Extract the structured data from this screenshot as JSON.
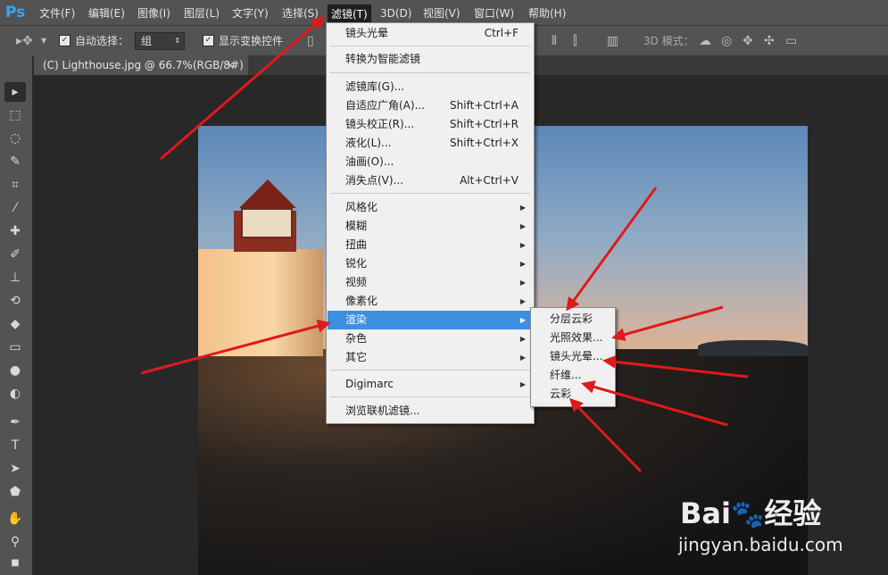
{
  "app": {
    "logo": "Ps"
  },
  "menubar": {
    "items": [
      "文件(F)",
      "编辑(E)",
      "图像(I)",
      "图层(L)",
      "文字(Y)",
      "选择(S)",
      "滤镜(T)",
      "3D(D)",
      "视图(V)",
      "窗口(W)",
      "帮助(H)"
    ],
    "active": "滤镜(T)"
  },
  "options": {
    "auto_select_label": "自动选择：",
    "group_value": "组",
    "show_transform_label": "显示变换控件",
    "mode_3d_label": "3D 模式："
  },
  "document": {
    "tab_title": "(C) Lighthouse.jpg @ 66.7%(RGB/8#)",
    "close": "×"
  },
  "filter_menu": {
    "items": [
      {
        "label": "镜头光晕",
        "shortcut": "Ctrl+F"
      },
      {
        "label": "转换为智能滤镜"
      },
      {
        "label": "滤镜库(G)..."
      },
      {
        "label": "自适应广角(A)...",
        "shortcut": "Shift+Ctrl+A"
      },
      {
        "label": "镜头校正(R)...",
        "shortcut": "Shift+Ctrl+R"
      },
      {
        "label": "液化(L)...",
        "shortcut": "Shift+Ctrl+X"
      },
      {
        "label": "油画(O)..."
      },
      {
        "label": "消失点(V)...",
        "shortcut": "Alt+Ctrl+V"
      },
      {
        "label": "风格化",
        "submenu": true
      },
      {
        "label": "模糊",
        "submenu": true
      },
      {
        "label": "扭曲",
        "submenu": true
      },
      {
        "label": "锐化",
        "submenu": true
      },
      {
        "label": "视频",
        "submenu": true
      },
      {
        "label": "像素化",
        "submenu": true
      },
      {
        "label": "渲染",
        "submenu": true,
        "highlighted": true
      },
      {
        "label": "杂色",
        "submenu": true
      },
      {
        "label": "其它",
        "submenu": true
      },
      {
        "label": "Digimarc",
        "submenu": true
      },
      {
        "label": "浏览联机滤镜..."
      }
    ]
  },
  "render_submenu": {
    "items": [
      "分层云彩",
      "光照效果...",
      "镜头光晕...",
      "纤维...",
      "云彩"
    ]
  },
  "watermark": {
    "brand_left": "Bai",
    "brand_right": "经验",
    "url": "jingyan.baidu.com"
  },
  "colors": {
    "highlight": "#3d8fe0",
    "annotation_arrow": "#e0191b",
    "ps_blue": "#31a8ff"
  }
}
